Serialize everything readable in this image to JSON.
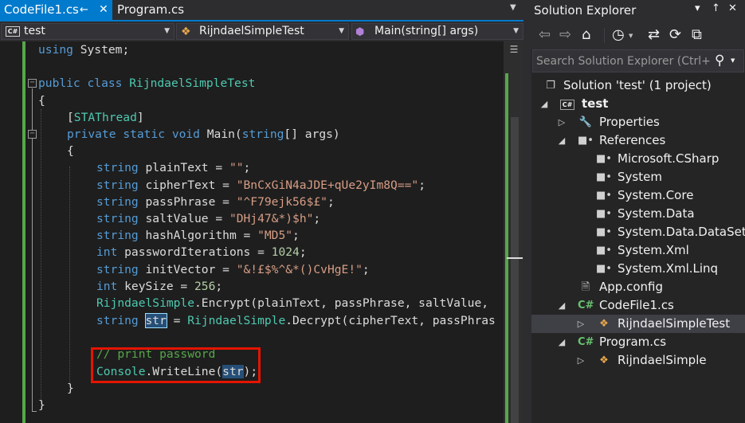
{
  "editor": {
    "tabs": [
      {
        "label": "CodeFile1.cs",
        "active": true,
        "pin": "←",
        "close": "✕"
      },
      {
        "label": "Program.cs",
        "active": false
      }
    ],
    "nav": {
      "project": "test",
      "type": "RijndaelSimpleTest",
      "member": "Main(string[] args)"
    },
    "colors": {
      "accent": "#007acc",
      "keyword": "#569cd6",
      "type": "#4ec9b0",
      "string": "#d69d85",
      "number": "#b5cea8",
      "comment": "#57a64a",
      "highlight_box": "#e51400"
    },
    "code": {
      "l01_kw": "using",
      "l01_rest": " System;",
      "l03_kw1": "public",
      "l03_kw2": "class",
      "l03_name": "RijndaelSimpleTest",
      "l04": "{",
      "l05_open": "[",
      "l05_attr": "STAThread",
      "l05_close": "]",
      "l06_kw1": "private",
      "l06_kw2": "static",
      "l06_kw3": "void",
      "l06_name": " Main(",
      "l06_kw4": "string",
      "l06_rest": "[] args)",
      "l07": "{",
      "l08_kw": "string",
      "l08_mid": " plainText = ",
      "l08_str": "\"\"",
      "l08_end": ";",
      "l09_kw": "string",
      "l09_mid": " cipherText = ",
      "l09_str": "\"BnCxGiN4aJDE+qUe2yIm8Q==\"",
      "l09_end": ";",
      "l10_kw": "string",
      "l10_mid": " passPhrase = ",
      "l10_str": "\"^F79ejk56$£\"",
      "l10_end": ";",
      "l11_kw": "string",
      "l11_mid": " saltValue = ",
      "l11_str": "\"DHj47&*)$h\"",
      "l11_end": ";",
      "l12_kw": "string",
      "l12_mid": " hashAlgorithm = ",
      "l12_str": "\"MD5\"",
      "l12_end": ";",
      "l13_kw": "int",
      "l13_mid": " passwordIterations = ",
      "l13_num": "1024",
      "l13_end": ";",
      "l14_kw": "string",
      "l14_mid": " initVector = ",
      "l14_str": "\"&!£$%^&*()CvHgE!\"",
      "l14_end": ";",
      "l15_kw": "int",
      "l15_mid": " keySize = ",
      "l15_num": "256",
      "l15_end": ";",
      "l16_type": "RijndaelSimple",
      "l16_rest": ".Encrypt(plainText, passPhrase, saltValue,",
      "l17_kw": "string",
      "l17_sp": " ",
      "l17_var": "str",
      "l17_mid": " = ",
      "l17_type": "RijndaelSimple",
      "l17_rest": ".Decrypt(cipherText, passPhras",
      "l19_comment": "// print password",
      "l20_type": "Console",
      "l20_mid": ".WriteLine(",
      "l20_var": "str",
      "l20_end": ");",
      "l21": "}",
      "l22": "}"
    }
  },
  "solution_explorer": {
    "title": "Solution Explorer",
    "title_buttons": {
      "dropdown": "▾",
      "pin": "↑",
      "close": "✕"
    },
    "search_placeholder": "Search Solution Explorer (Ctrl+;)",
    "icons": [
      "back-icon",
      "forward-icon",
      "home-icon",
      "history-icon",
      "sync-icon",
      "refresh-icon",
      "collapse-all-icon",
      "search-icon"
    ],
    "tree": {
      "solution": "Solution 'test' (1 project)",
      "project": "test",
      "properties": "Properties",
      "references": "References",
      "refs": [
        "Microsoft.CSharp",
        "System",
        "System.Core",
        "System.Data",
        "System.Data.DataSetExt",
        "System.Xml",
        "System.Xml.Linq"
      ],
      "app_config": "App.config",
      "codefile": "CodeFile1.cs",
      "codefile_class": "RijndaelSimpleTest",
      "program": "Program.cs",
      "program_class": "RijndaelSimple"
    }
  }
}
